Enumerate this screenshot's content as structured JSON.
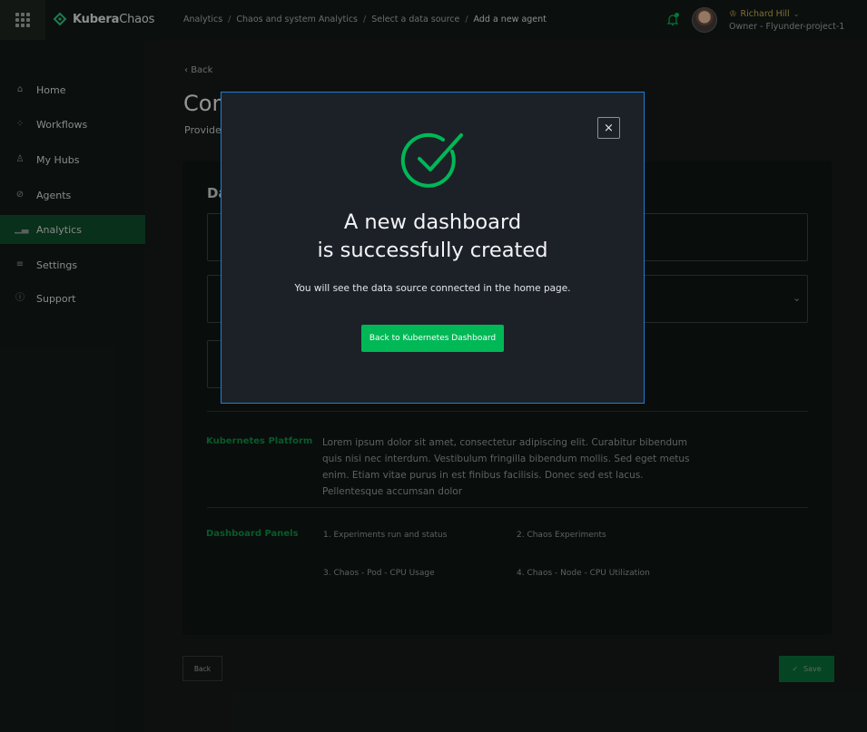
{
  "header": {
    "logo_bold": "Kubera",
    "logo_light": "Chaos",
    "breadcrumb": [
      "Analytics",
      "Chaos and system Analytics",
      "Select a data source",
      "Add a new agent"
    ],
    "breadcrumb_sep": "/",
    "user": {
      "name": "Richard Hill",
      "role": "Owner - Flyunder-project-1"
    }
  },
  "sidebar": {
    "items": [
      {
        "label": "Home",
        "icon": "home-icon"
      },
      {
        "label": "Workflows",
        "icon": "workflows-icon"
      },
      {
        "label": "My Hubs",
        "icon": "hubs-icon"
      },
      {
        "label": "Agents",
        "icon": "agents-icon"
      },
      {
        "label": "Analytics",
        "icon": "analytics-icon",
        "active": true
      },
      {
        "label": "Settings",
        "icon": "settings-icon"
      },
      {
        "label": "Support",
        "icon": "support-icon"
      }
    ]
  },
  "main": {
    "back_label": "Back",
    "title": "Con",
    "subtitle": "Provide",
    "card_title": "Da",
    "kubernetes_platform": {
      "label": "Kubernetes Platform",
      "text": "Lorem ipsum dolor sit amet, consectetur adipiscing elit. Curabitur bibendum quis nisi nec interdum. Vestibulum fringilla bibendum mollis. Sed eget metus enim. Etiam vitae purus in est finibus facilisis. Donec sed est lacus. Pellentesque accumsan dolor"
    },
    "dashboard_panels": {
      "label": "Dashboard Panels",
      "items": [
        "1. Experiments run and status",
        "2. Chaos Experiments",
        "3. Chaos - Pod - CPU Usage",
        "4. Chaos - Node - CPU Utilization"
      ]
    },
    "footer": {
      "back_button": "Back",
      "save_button": "Save"
    }
  },
  "modal": {
    "title_line1": "A new dashboard",
    "title_line2": "is successfully created",
    "description": "You will see the data source connected in the home page.",
    "button": "Back to Kubernetes Dashboard",
    "close": "×"
  },
  "colors": {
    "accent": "#00b856",
    "modal_border": "#1d7fd8",
    "user_name": "#c9a94b"
  }
}
